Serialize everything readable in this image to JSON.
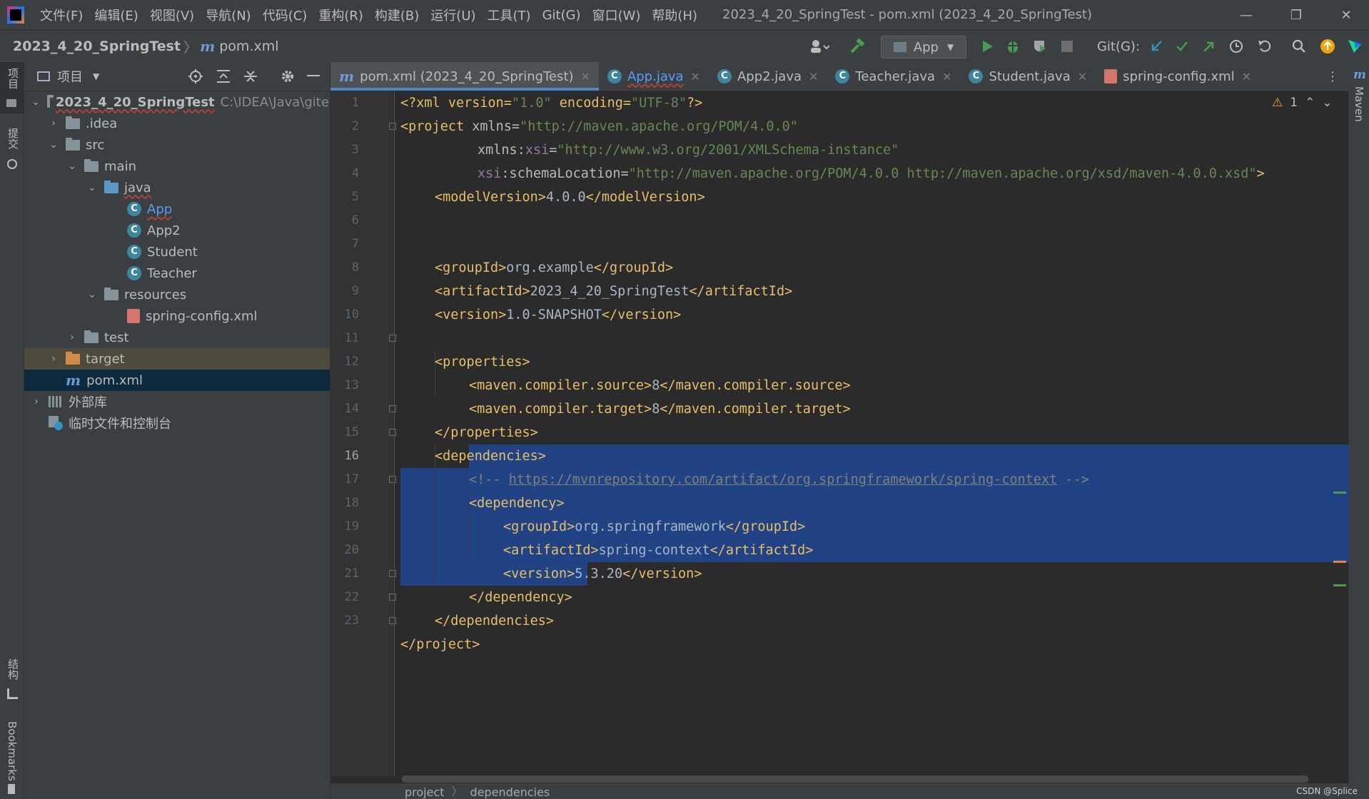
{
  "menu": [
    "文件(F)",
    "编辑(E)",
    "视图(V)",
    "导航(N)",
    "代码(C)",
    "重构(R)",
    "构建(B)",
    "运行(U)",
    "工具(T)",
    "Git(G)",
    "窗口(W)",
    "帮助(H)"
  ],
  "window_title": "2023_4_20_SpringTest - pom.xml (2023_4_20_SpringTest)",
  "window_controls": {
    "minimize": "—",
    "restore": "❐",
    "close": "✕"
  },
  "navbar": {
    "project": "2023_4_20_SpringTest",
    "sep": "〉",
    "file_icon": "m",
    "file": "pom.xml",
    "run_config": "App",
    "git_label": "Git(G):"
  },
  "left_stripe": {
    "project": "项目",
    "commit": "提交",
    "structure": "结构",
    "bookmarks": "Bookmarks"
  },
  "right_stripe": {
    "maven": "Maven"
  },
  "project_panel": {
    "title": "项目",
    "tree": [
      {
        "label": "2023_4_20_SpringTest",
        "hint": "C:\\IDEA\\Java\\gitee"
      },
      {
        "label": ".idea"
      },
      {
        "label": "src"
      },
      {
        "label": "main"
      },
      {
        "label": "java"
      },
      {
        "label": "App"
      },
      {
        "label": "App2"
      },
      {
        "label": "Student"
      },
      {
        "label": "Teacher"
      },
      {
        "label": "resources"
      },
      {
        "label": "spring-config.xml"
      },
      {
        "label": "test"
      },
      {
        "label": "target"
      },
      {
        "label": "pom.xml"
      },
      {
        "label": "外部库"
      },
      {
        "label": "临时文件和控制台"
      }
    ]
  },
  "tabs": [
    {
      "label": "pom.xml (2023_4_20_SpringTest)"
    },
    {
      "label": "App.java"
    },
    {
      "label": "App2.java"
    },
    {
      "label": "Teacher.java"
    },
    {
      "label": "Student.java"
    },
    {
      "label": "spring-config.xml"
    }
  ],
  "inspection": {
    "count": "1"
  },
  "line_numbers": [
    "1",
    "2",
    "3",
    "4",
    "5",
    "6",
    "7",
    "8",
    "9",
    "10",
    "11",
    "12",
    "13",
    "14",
    "15",
    "16",
    "17",
    "18",
    "19",
    "20",
    "21",
    "22",
    "23"
  ],
  "code": {
    "l1_pi": "<?xml version=",
    "l1_v": "\"1.0\"",
    "l1_enc": " encoding=",
    "l1_ev": "\"UTF-8\"",
    "l1_end": "?>",
    "l2_tag": "<project",
    "l2_attr": " xmlns=",
    "l2_val": "\"http://maven.apache.org/POM/4.0.0\"",
    "l3_attr": "xmlns:",
    "l3_ns": "xsi",
    "l3_eq": "=",
    "l3_val": "\"http://www.w3.org/2001/XMLSchema-instance\"",
    "l4_ns": "xsi",
    "l4_attr": ":schemaLocation=",
    "l4_val": "\"http://maven.apache.org/POM/4.0.0 http://maven.apache.org/xsd/maven-4.0.0.xsd\"",
    "l4_end": ">",
    "l5_open": "<modelVersion>",
    "l5_text": "4.0.0",
    "l5_close": "</modelVersion>",
    "l7_open": "<groupId>",
    "l7_text": "org.example",
    "l7_close": "</groupId>",
    "l8_open": "<artifactId>",
    "l8_text": "2023_4_20_SpringTest",
    "l8_close": "</artifactId>",
    "l9_open": "<version>",
    "l9_text": "1.0-SNAPSHOT",
    "l9_close": "</version>",
    "l11": "<properties>",
    "l12_open": "<maven.compiler.source>",
    "l12_text": "8",
    "l12_close": "</maven.compiler.source>",
    "l13_open": "<maven.compiler.target>",
    "l13_text": "8",
    "l13_close": "</maven.compiler.target>",
    "l14": "</properties>",
    "l15": "<dependencies>",
    "l16_open": "<!-- ",
    "l16_link": "https://mvnrepository.com/artifact/org.springframework/spring-context",
    "l16_close": " -->",
    "l17": "<dependency>",
    "l18_open": "<groupId>",
    "l18_text": "org.springframework",
    "l18_close": "</groupId>",
    "l19_open": "<artifactId>",
    "l19_text": "spring-context",
    "l19_close": "</artifactId>",
    "l20_open": "<version>",
    "l20_text": "5.3.20",
    "l20_close": "</version>",
    "l21": "</dependency>",
    "l22": "</dependencies>",
    "l23": "</project>"
  },
  "breadcrumb": {
    "a": "project",
    "sep": "〉",
    "b": "dependencies"
  },
  "watermark": "CSDN @Splice",
  "colors": {
    "accent": "#4a88c7",
    "selection": "#214283",
    "tag": "#e8bf6a",
    "string": "#6a8759"
  }
}
